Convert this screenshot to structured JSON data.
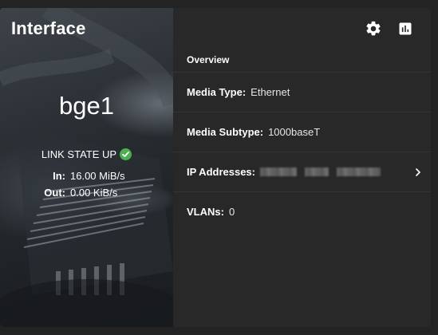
{
  "card": {
    "title": "Interface"
  },
  "interface": {
    "name": "bge1",
    "link_state": "LINK STATE UP",
    "link_status_color": "#4caf50",
    "in_label": "In:",
    "in_value": "16.00 MiB/s",
    "out_label": "Out:",
    "out_value": "0.00 KiB/s"
  },
  "toolbar": {
    "settings_icon": "gear-icon",
    "stats_icon": "bar-chart-icon"
  },
  "overview": {
    "heading": "Overview",
    "media_type_label": "Media Type:",
    "media_type_value": "Ethernet",
    "media_subtype_label": "Media Subtype:",
    "media_subtype_value": "1000baseT",
    "ip_label": "IP Addresses:",
    "ip_value_obscured": true,
    "vlans_label": "VLANs:",
    "vlans_value": "0"
  }
}
